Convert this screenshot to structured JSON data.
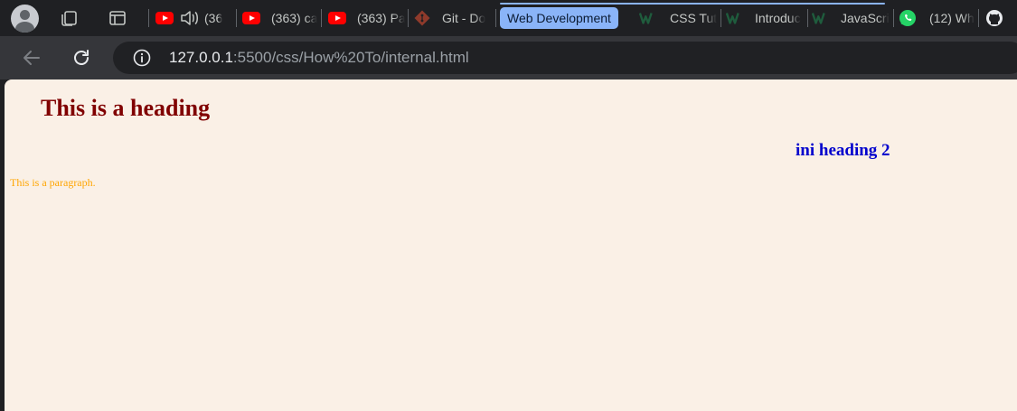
{
  "colors": {
    "tabstrip_bg": "#1f2023",
    "toolbar_bg": "#35363a",
    "omnibox_bg": "#202124",
    "tab_group": "#8ab4f8",
    "page_bg": "#faf0e6",
    "heading1": "#800000",
    "heading2": "#0000cd",
    "paragraph": "#ffa500"
  },
  "tabs": [
    {
      "icon": "youtube-icon",
      "title": "(36",
      "audio": true
    },
    {
      "icon": "youtube-icon",
      "title": "(363) ca"
    },
    {
      "icon": "youtube-icon",
      "title": "(363) Pa"
    },
    {
      "icon": "git-icon",
      "title": "Git - Do"
    },
    {
      "icon": "w3schools-icon",
      "title": "CSS Tut"
    },
    {
      "icon": "w3schools-icon",
      "title": "Introduc"
    },
    {
      "icon": "w3schools-icon",
      "title": "JavaScri"
    },
    {
      "icon": "whatsapp-icon",
      "title": "(12) Wh"
    },
    {
      "icon": "github-icon",
      "title": ""
    }
  ],
  "tab_group": {
    "label": "Web Development"
  },
  "address_bar": {
    "url_host": "127.0.0.1",
    "url_path": ":5500/css/How%20To/internal.html"
  },
  "page": {
    "heading1": "This is a heading",
    "heading2": "ini heading 2",
    "paragraph": "This is a paragraph."
  }
}
